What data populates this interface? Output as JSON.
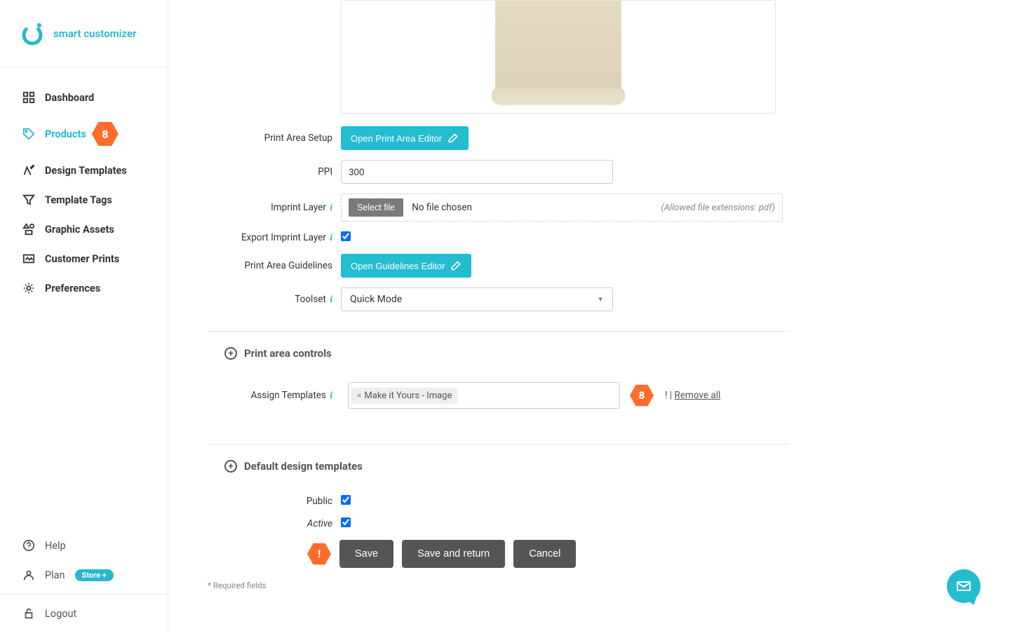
{
  "brand": {
    "name": "smart customizer"
  },
  "sidebar": {
    "items": [
      {
        "label": "Dashboard"
      },
      {
        "label": "Products",
        "badge": "8"
      },
      {
        "label": "Design Templates"
      },
      {
        "label": "Template Tags"
      },
      {
        "label": "Graphic Assets"
      },
      {
        "label": "Customer Prints"
      },
      {
        "label": "Preferences"
      }
    ],
    "help": "Help",
    "plan": "Plan",
    "plan_pill": "Store +",
    "logout": "Logout"
  },
  "form": {
    "print_area_setup_label": "Print Area Setup",
    "open_print_area_editor": "Open Print Area Editor",
    "ppi_label": "PPI",
    "ppi_value": "300",
    "imprint_layer_label": "Imprint Layer",
    "select_file": "Select file",
    "no_file": "No file chosen",
    "file_hint": "(Allowed file extensions: pdf)",
    "export_imprint_label": "Export Imprint Layer",
    "print_area_guidelines_label": "Print Area Guidelines",
    "open_guidelines_editor": "Open Guidelines Editor",
    "toolset_label": "Toolset",
    "toolset_value": "Quick Mode"
  },
  "sections": {
    "print_area_controls": "Print area controls",
    "default_design_templates": "Default design templates"
  },
  "assign": {
    "label": "Assign Templates",
    "tag": "Make it Yours - Image",
    "badge": "8",
    "sep": "|",
    "remove_all": "Remove all",
    "bang": "!"
  },
  "bottom": {
    "public": "Public",
    "active": "Active",
    "save": "Save",
    "save_return": "Save and return",
    "cancel": "Cancel",
    "alert": "!",
    "required": "* Required fields"
  }
}
